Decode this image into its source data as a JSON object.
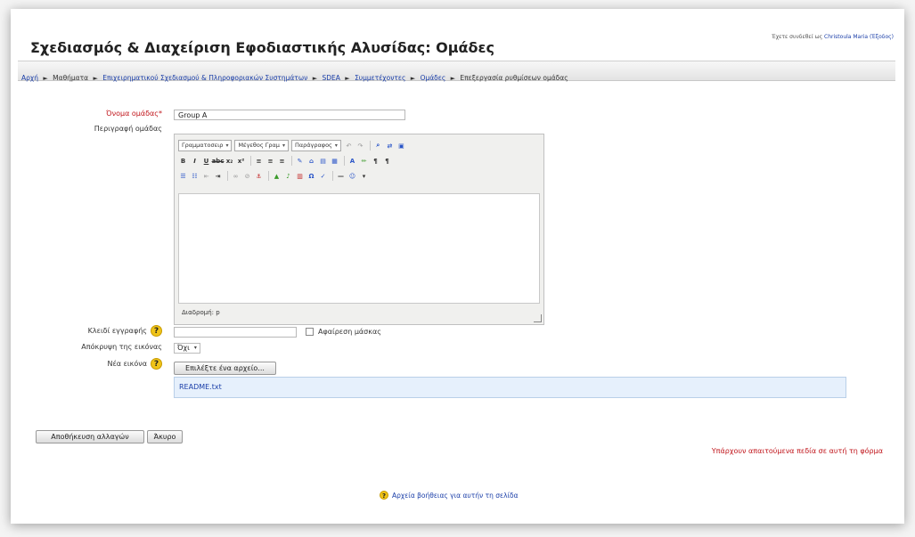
{
  "header": {
    "title": "Σχεδιασμός & Διαχείριση Εφοδιαστικής Αλυσίδας: Ομάδες",
    "login_prefix": "Έχετε συνδεθεί ως",
    "login_user": "Christoula Maria (Έξοδος)"
  },
  "breadcrumb": [
    {
      "label": "Αρχή",
      "link": true
    },
    {
      "label": "Μαθήματα",
      "link": false
    },
    {
      "label": "Επιχειρηματικού Σχεδιασμού & Πληροφοριακών Συστημάτων",
      "link": true
    },
    {
      "label": "SDEA",
      "link": true
    },
    {
      "label": "Συμμετέχοντες",
      "link": true
    },
    {
      "label": "Ομάδες",
      "link": true
    },
    {
      "label": "Επεξεργασία ρυθμίσεων ομάδας",
      "link": false
    }
  ],
  "form": {
    "group_name_label": "Όνομα ομάδας",
    "group_name_value": "Group A",
    "description_label": "Περιγραφή ομάδας",
    "editor": {
      "font_family": "Γραμματοσειρ",
      "font_size": "Μέγεθος Γραμ",
      "format": "Παράγραφος",
      "path_label": "Διαδρομή: p"
    },
    "enrolment_key_label": "Κλειδί εγγραφής",
    "unmask_label": "Αφαίρεση μάσκας",
    "hide_picture_label": "Απόκρυψη της εικόνας",
    "hide_picture_value": "Όχι",
    "new_picture_label": "Νέα εικόνα",
    "choose_file_label": "Επιλέξτε ένα αρχείο...",
    "attached_file": "README.txt"
  },
  "actions": {
    "save_label": "Αποθήκευση αλλαγών",
    "cancel_label": "Άκυρο"
  },
  "required_note": "Υπάρχουν απαιτούμενα πεδία σε αυτή τη φόρμα",
  "help_link": "Αρχεία βοήθειας για αυτήν τη σελίδα",
  "colors": {
    "link": "#1a3ea8",
    "required": "#c0141a",
    "help": "#f0c419"
  }
}
